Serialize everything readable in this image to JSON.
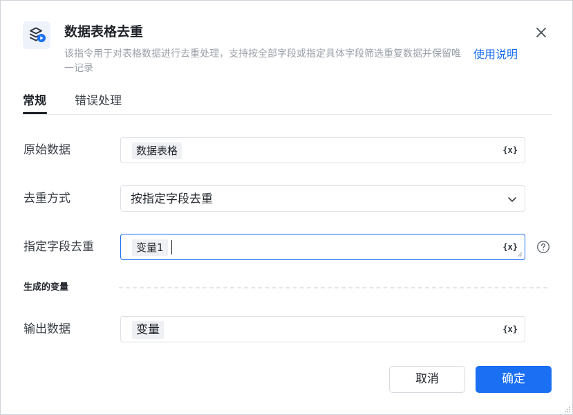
{
  "header": {
    "icon": "dedupe-table-icon",
    "title": "数据表格去重",
    "description": "该指令用于对表格数据进行去重处理，支持按全部字段或指定具体字段筛选重复数据并保留唯一记录",
    "help_link": "使用说明"
  },
  "tabs": [
    {
      "label": "常规",
      "active": true
    },
    {
      "label": "错误处理",
      "active": false
    }
  ],
  "fields": {
    "source": {
      "label": "原始数据",
      "tag": "数据表格",
      "var_button": "{x}"
    },
    "method": {
      "label": "去重方式",
      "value": "按指定字段去重"
    },
    "specified": {
      "label": "指定字段去重",
      "tag": "变量1",
      "var_button": "{x}"
    }
  },
  "output_section": {
    "title": "生成的变量",
    "output": {
      "label": "输出数据",
      "tag": "变量",
      "var_button": "{x}"
    }
  },
  "footer": {
    "cancel_label": "取消",
    "ok_label": "确定"
  },
  "colors": {
    "primary": "#1a6ff2",
    "text": "#1f2329",
    "muted": "#9aa0a8",
    "border": "#dcdfe4"
  }
}
